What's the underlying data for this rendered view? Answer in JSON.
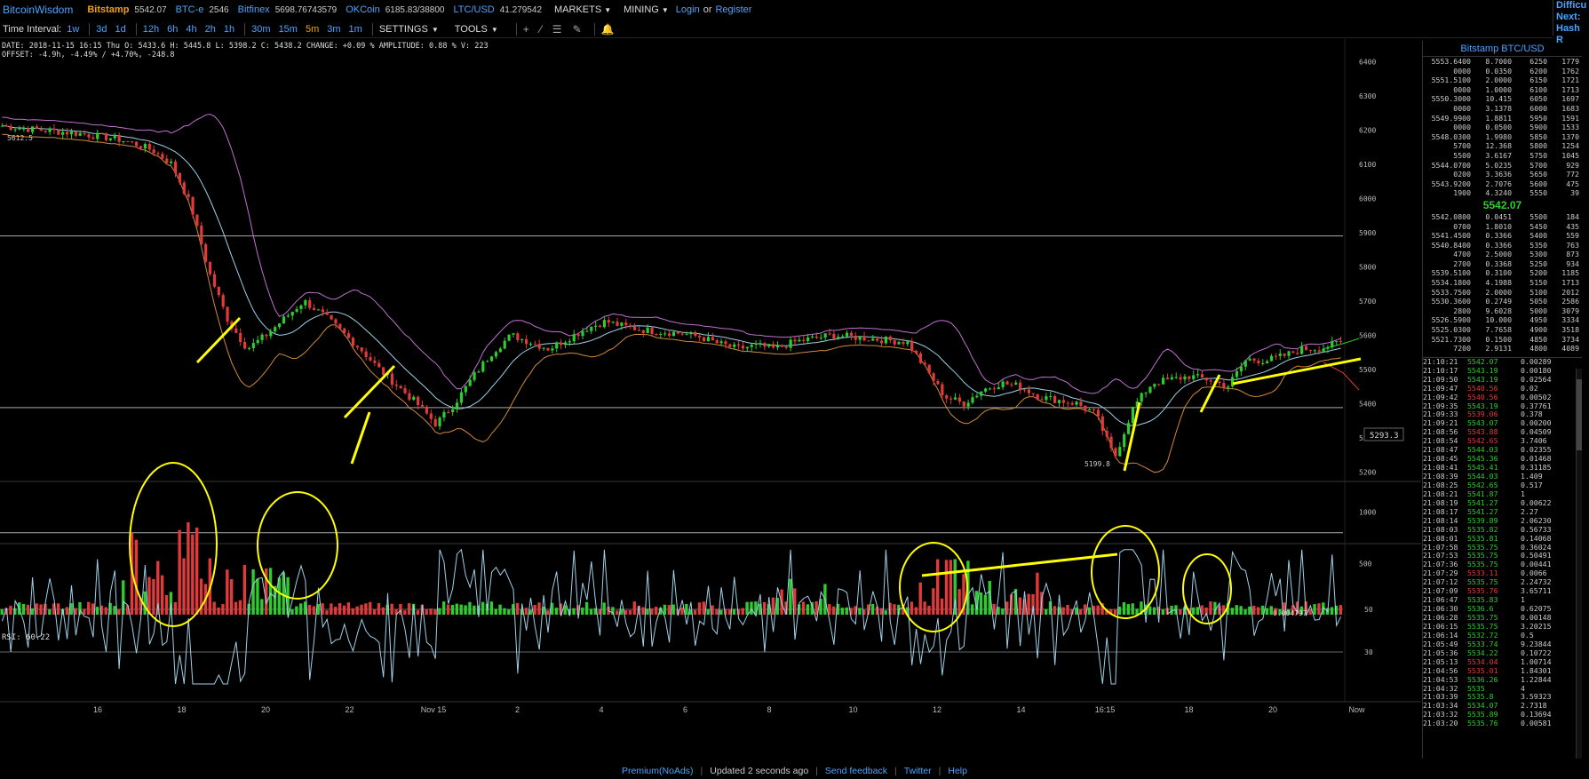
{
  "topbar": {
    "brand": "BitcoinWisdom",
    "exchanges": [
      {
        "name": "Bitstamp",
        "price": "5542.07",
        "active": true
      },
      {
        "name": "BTC-e",
        "price": "2546",
        "active": false
      },
      {
        "name": "Bitfinex",
        "price": "5698.76743579",
        "active": false
      },
      {
        "name": "OKCoin",
        "price": "6185.83/38800",
        "active": false
      },
      {
        "name": "LTC/USD",
        "price": "41.279542",
        "active": false
      }
    ],
    "markets_label": "MARKETS",
    "mining_label": "MINING",
    "login_label": "Login",
    "or_label": "or",
    "register_label": "Register"
  },
  "corner": [
    "Difficu",
    "Next:",
    "Hash R"
  ],
  "toolbar": {
    "label": "Time Interval:",
    "intervals": [
      "1w",
      "3d",
      "1d",
      "12h",
      "6h",
      "4h",
      "2h",
      "1h",
      "30m",
      "15m",
      "5m",
      "3m",
      "1m"
    ],
    "active_interval": "5m",
    "settings_label": "SETTINGS",
    "tools_label": "TOOLS"
  },
  "info": {
    "line1": "DATE: 2018-11-15 16:15 Thu   O: 5433.6   H: 5445.8   L: 5398.2   C: 5438.2   CHANGE: +0.09 %   AMPLITUDE: 0.88 %   V: 223",
    "line2": "OFFSET: -4.9h, -4.49% / +4.70%, -248.8"
  },
  "chart_data": {
    "type": "candlestick",
    "price_ticks": [
      5200,
      5300,
      5400,
      5500,
      5600,
      5700,
      5800,
      5900,
      6000,
      6100,
      6200,
      6300,
      6400
    ],
    "price_range": [
      5180,
      6450
    ],
    "x_labels": [
      "16",
      "18",
      "20",
      "22",
      "Nov 15",
      "2",
      "4",
      "6",
      "8",
      "10",
      "12",
      "14",
      "16:15",
      "18",
      "20",
      "Now"
    ],
    "close_series": [
      6212,
      6205,
      6200,
      6195,
      6190,
      6182,
      6175,
      6160,
      6140,
      6100,
      5980,
      5780,
      5640,
      5560,
      5600,
      5650,
      5700,
      5660,
      5610,
      5560,
      5500,
      5450,
      5400,
      5340,
      5400,
      5480,
      5550,
      5600,
      5580,
      5560,
      5590,
      5620,
      5640,
      5625,
      5615,
      5610,
      5605,
      5595,
      5575,
      5560,
      5570,
      5560,
      5580,
      5590,
      5600,
      5595,
      5590,
      5585,
      5580,
      5500,
      5420,
      5400,
      5440,
      5460,
      5450,
      5420,
      5410,
      5400,
      5370,
      5240,
      5390,
      5460,
      5470,
      5480,
      5470,
      5450,
      5530,
      5525,
      5540,
      5560,
      5562,
      5580
    ],
    "last_price_label": "5612.5",
    "low_marker": "5199.8",
    "cursor_price": "5293.3",
    "volume_ticks": [
      500,
      1000
    ],
    "volume_last": "0.004797",
    "rsi_label": "RSI: 60.22",
    "rsi_ticks": [
      30,
      50
    ]
  },
  "orderbook": {
    "title": "Bitstamp BTC/USD",
    "asks": [
      [
        "5553.6400",
        "8.7000",
        "6250",
        "1779"
      ],
      [
        "0000",
        "0.0350",
        "6200",
        "1762"
      ],
      [
        "5551.5100",
        "2.0000",
        "6150",
        "1721"
      ],
      [
        "0000",
        "1.0000",
        "6100",
        "1713"
      ],
      [
        "5550.3000",
        "10.415",
        "6050",
        "1697"
      ],
      [
        "0000",
        "3.1378",
        "6000",
        "1683"
      ],
      [
        "5549.9900",
        "1.8811",
        "5950",
        "1591"
      ],
      [
        "0000",
        "0.0500",
        "5900",
        "1533"
      ],
      [
        "5548.0300",
        "1.9980",
        "5850",
        "1370"
      ],
      [
        "5700",
        "12.368",
        "5800",
        "1254"
      ],
      [
        "5500",
        "3.6167",
        "5750",
        "1045"
      ],
      [
        "5544.0700",
        "5.0235",
        "5700",
        "929"
      ],
      [
        "0200",
        "3.3636",
        "5650",
        "772"
      ],
      [
        "5543.9200",
        "2.7076",
        "5600",
        "475"
      ],
      [
        "1900",
        "4.3240",
        "5550",
        "39"
      ]
    ],
    "current": "5542.07",
    "bids": [
      [
        "5542.0800",
        "0.0451",
        "5500",
        "184"
      ],
      [
        "0700",
        "1.8010",
        "5450",
        "435"
      ],
      [
        "5541.4500",
        "0.3366",
        "5400",
        "559"
      ],
      [
        "5540.8400",
        "0.3366",
        "5350",
        "763"
      ],
      [
        "4700",
        "2.5000",
        "5300",
        "873"
      ],
      [
        "2700",
        "0.3368",
        "5250",
        "934"
      ],
      [
        "5539.5100",
        "0.3100",
        "5200",
        "1185"
      ],
      [
        "5534.1800",
        "4.1988",
        "5150",
        "1713"
      ],
      [
        "5533.7500",
        "2.0000",
        "5100",
        "2012"
      ],
      [
        "5530.3600",
        "0.2749",
        "5050",
        "2586"
      ],
      [
        "2800",
        "9.6028",
        "5000",
        "3079"
      ],
      [
        "5526.5900",
        "10.000",
        "4950",
        "3334"
      ],
      [
        "5525.0300",
        "7.7658",
        "4900",
        "3518"
      ],
      [
        "5521.7300",
        "0.1500",
        "4850",
        "3734"
      ],
      [
        "7200",
        "2.9131",
        "4800",
        "4089"
      ]
    ]
  },
  "trades": [
    [
      "21:10:21",
      "5542.07",
      "0.00289",
      "up"
    ],
    [
      "21:10:17",
      "5543.19",
      "0.00180",
      "up"
    ],
    [
      "21:09:50",
      "5543.19",
      "0.02564",
      "up"
    ],
    [
      "21:09:47",
      "5540.56",
      "0.02",
      "down"
    ],
    [
      "21:09:42",
      "5540.56",
      "0.00502",
      "down"
    ],
    [
      "21:09:35",
      "5543.19",
      "0.37761",
      "up"
    ],
    [
      "21:09:33",
      "5539.06",
      "0.378",
      "down"
    ],
    [
      "21:09:21",
      "5543.07",
      "0.00200",
      "up"
    ],
    [
      "21:08:56",
      "5543.88",
      "0.04509",
      "down"
    ],
    [
      "21:08:54",
      "5542.65",
      "3.7406",
      "down"
    ],
    [
      "21:08:47",
      "5544.03",
      "0.02355",
      "up"
    ],
    [
      "21:08:45",
      "5545.36",
      "0.01468",
      "up"
    ],
    [
      "21:08:41",
      "5545.41",
      "0.31185",
      "up"
    ],
    [
      "21:08:39",
      "5544.03",
      "1.409",
      "up"
    ],
    [
      "21:08:25",
      "5542.65",
      "0.517",
      "up"
    ],
    [
      "21:08:21",
      "5541.87",
      "1",
      "up"
    ],
    [
      "21:08:19",
      "5541.27",
      "0.00622",
      "up"
    ],
    [
      "21:08:17",
      "5541.27",
      "2.27",
      "up"
    ],
    [
      "21:08:14",
      "5539.89",
      "2.06230",
      "up"
    ],
    [
      "21:08:03",
      "5535.82",
      "0.56733",
      "up"
    ],
    [
      "21:08:01",
      "5535.81",
      "0.14068",
      "up"
    ],
    [
      "21:07:58",
      "5535.75",
      "0.36024",
      "up"
    ],
    [
      "21:07:53",
      "5535.75",
      "0.50491",
      "up"
    ],
    [
      "21:07:36",
      "5535.75",
      "0.00441",
      "up"
    ],
    [
      "21:07:29",
      "5533.11",
      "0.0066",
      "down"
    ],
    [
      "21:07:12",
      "5535.75",
      "2.24732",
      "up"
    ],
    [
      "21:07:09",
      "5535.76",
      "3.65711",
      "down"
    ],
    [
      "21:06:47",
      "5535.83",
      "1",
      "up"
    ],
    [
      "21:06:30",
      "5536.6",
      "0.62075",
      "up"
    ],
    [
      "21:06:28",
      "5535.75",
      "0.00148",
      "up"
    ],
    [
      "21:06:15",
      "5535.75",
      "3.20215",
      "up"
    ],
    [
      "21:06:14",
      "5532.72",
      "0.5",
      "up"
    ],
    [
      "21:05:49",
      "5533.74",
      "9.23844",
      "up"
    ],
    [
      "21:05:36",
      "5534.22",
      "0.10722",
      "up"
    ],
    [
      "21:05:13",
      "5534.04",
      "1.00714",
      "down"
    ],
    [
      "21:04:56",
      "5535.01",
      "1.84301",
      "down"
    ],
    [
      "21:04:53",
      "5536.26",
      "1.22844",
      "up"
    ],
    [
      "21:04:32",
      "5535",
      "4",
      "up"
    ],
    [
      "21:03:39",
      "5535.8",
      "3.59323",
      "up"
    ],
    [
      "21:03:34",
      "5534.07",
      "2.7318",
      "up"
    ],
    [
      "21:03:32",
      "5535.89",
      "0.13694",
      "up"
    ],
    [
      "21:03:20",
      "5535.76",
      "0.00581",
      "up"
    ]
  ],
  "footer": {
    "premium": "Premium(NoAds)",
    "updated": "Updated 2 seconds ago",
    "feedback": "Send feedback",
    "twitter": "Twitter",
    "help": "Help"
  },
  "colors": {
    "up": "#2ecc2e",
    "down": "#e03a3a",
    "link": "#4aa3ff",
    "accent": "#f0a000",
    "annotation": "#ffff00"
  }
}
